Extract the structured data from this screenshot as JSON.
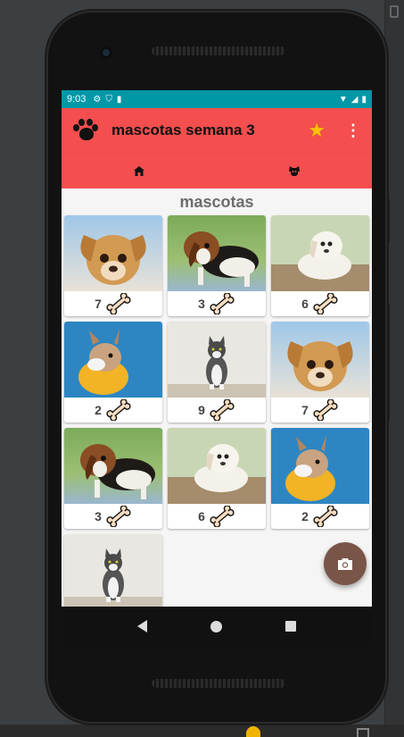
{
  "status_bar": {
    "time": "9:03",
    "icons": [
      "gear-icon",
      "shield-icon",
      "sd-card-icon"
    ],
    "right_icons": [
      "wifi-icon",
      "signal-icon",
      "battery-icon"
    ],
    "color": "#0097a7"
  },
  "app_bar": {
    "title": "mascotas semana 3",
    "logo_icon": "paw-icon",
    "action_icon": "star-icon",
    "overflow_icon": "more-vert-icon",
    "color": "#f44e4e"
  },
  "tabs": [
    {
      "icon": "home-icon",
      "selected": true
    },
    {
      "icon": "dog-face-icon",
      "selected": false
    }
  ],
  "section_title": "mascotas",
  "pets": [
    {
      "kind": "puppy-tan",
      "likes": "7"
    },
    {
      "kind": "beagle",
      "likes": "3"
    },
    {
      "kind": "white-puppy",
      "likes": "6"
    },
    {
      "kind": "french-bulldog",
      "likes": "2"
    },
    {
      "kind": "cat",
      "likes": "9"
    },
    {
      "kind": "puppy-tan",
      "likes": "7"
    },
    {
      "kind": "beagle",
      "likes": "3"
    },
    {
      "kind": "white-puppy",
      "likes": "6"
    },
    {
      "kind": "french-bulldog",
      "likes": "2"
    },
    {
      "kind": "cat",
      "likes": ""
    }
  ],
  "like_icon": "bone-icon",
  "fab": {
    "icon": "camera-icon",
    "color": "#795548"
  },
  "nav_bar": [
    "back-icon",
    "home-circle-icon",
    "recents-icon"
  ]
}
